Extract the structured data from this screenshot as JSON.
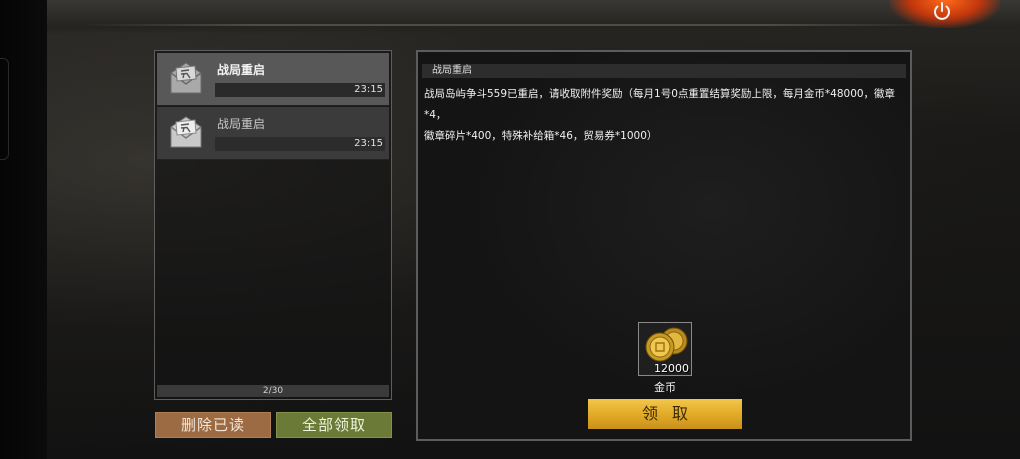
{
  "window": {
    "power_icon": "power-icon"
  },
  "mail_list": {
    "items": [
      {
        "title": "战局重启",
        "time": "23:15",
        "icon": "envelope-icon",
        "selected": true
      },
      {
        "title": "战局重启",
        "time": "23:15",
        "icon": "envelope-icon",
        "selected": false
      }
    ],
    "page_indicator": "2/30"
  },
  "actions": {
    "delete_read": "删除已读",
    "claim_all": "全部领取"
  },
  "detail": {
    "header": "战局重启",
    "body_line1": "战局岛屿争斗559已重启，请收取附件奖励（每月1号0点重置结算奖励上限，每月金币*48000，徽章*4，",
    "body_line2": "徽章碎片*400，特殊补给箱*46，贸易券*1000）",
    "reward": {
      "icon": "gold-coins-icon",
      "count": "12000",
      "label": "金币"
    },
    "claim_label": "领取"
  },
  "colors": {
    "claim_gold": "#e0a925",
    "delete_brown": "#9c6b43",
    "claim_all_green": "#6b7a37",
    "power_orange": "#ff6a1a"
  }
}
